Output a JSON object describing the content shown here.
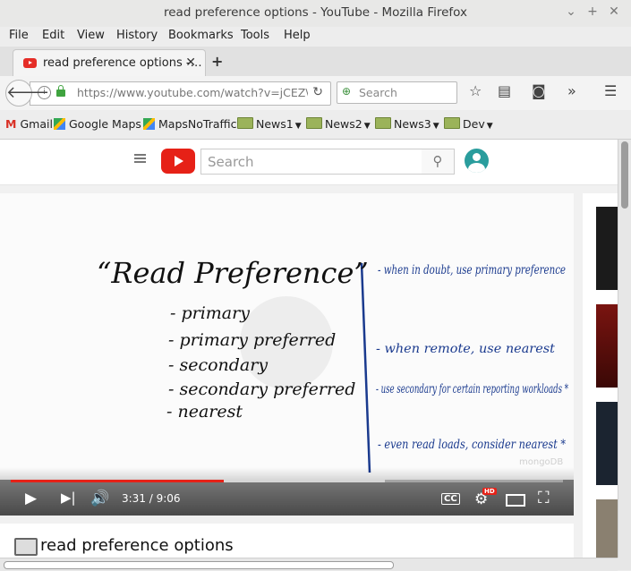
{
  "window": {
    "title": "read preference options - YouTube - Mozilla Firefox",
    "controls": [
      "minimize-icon",
      "maximize-icon",
      "close-icon"
    ]
  },
  "menu": [
    "File",
    "Edit",
    "View",
    "History",
    "Bookmarks",
    "Tools",
    "Help"
  ],
  "tab": {
    "title": "read preference options -…"
  },
  "navbar": {
    "url": "https://www.youtube.com/watch?v=jCEZ\\",
    "search_placeholder": "Search"
  },
  "bookmarks": [
    "Gmail",
    "Google Maps",
    "MapsNoTraffic",
    "News1",
    "News2",
    "News3",
    "Dev"
  ],
  "youtube": {
    "search_placeholder": "Search",
    "video": {
      "current_time": "3:31",
      "duration": "9:06",
      "time_display": "3:31 / 9:06",
      "progress_fraction": 0.386,
      "quality_badge": "HD",
      "watermark": "mongoDB",
      "cc_label": "CC",
      "whiteboard": {
        "heading": "“Read Preference”",
        "left_items": [
          "- primary",
          "- primary preferred",
          "- secondary",
          "- secondary preferred",
          "- nearest"
        ],
        "right_notes": [
          "- when in doubt, use primary preference",
          "- when remote, use nearest",
          "- use secondary for certain reporting workloads *",
          "- even read loads, consider nearest *"
        ]
      }
    },
    "video_title": "read preference options"
  }
}
